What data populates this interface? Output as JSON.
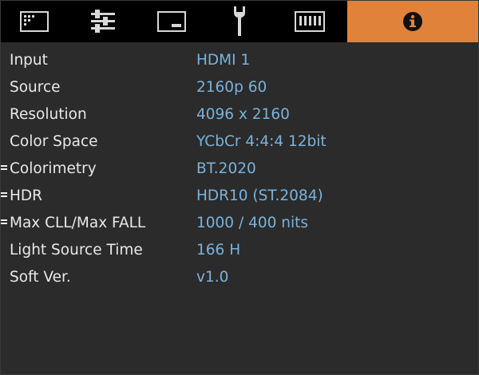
{
  "menu": {
    "tabs": [
      {
        "icon": "picture-icon"
      },
      {
        "icon": "adjustments-icon"
      },
      {
        "icon": "display-icon"
      },
      {
        "icon": "wrench-icon"
      },
      {
        "icon": "keyboard-icon"
      },
      {
        "icon": "info-icon"
      }
    ],
    "active_tab_color": "#e0823a"
  },
  "info": {
    "rows": [
      {
        "label": "Input",
        "value": "HDMI 1"
      },
      {
        "label": "Source",
        "value": "2160p 60"
      },
      {
        "label": "Resolution",
        "value": "4096 x 2160"
      },
      {
        "label": "Color Space",
        "value": "YCbCr 4:4:4 12bit"
      },
      {
        "label": "Colorimetry",
        "value": "BT.2020"
      },
      {
        "label": "HDR",
        "value": "HDR10 (ST.2084)"
      },
      {
        "label": "Max CLL/Max FALL",
        "value": "1000 / 400 nits"
      },
      {
        "label": "Light Source Time",
        "value": "166 H"
      },
      {
        "label": "Soft Ver.",
        "value": "v1.0"
      }
    ]
  },
  "colors": {
    "background": "#2b2b2b",
    "label": "#e8e8e8",
    "value": "#7ab2dc"
  }
}
